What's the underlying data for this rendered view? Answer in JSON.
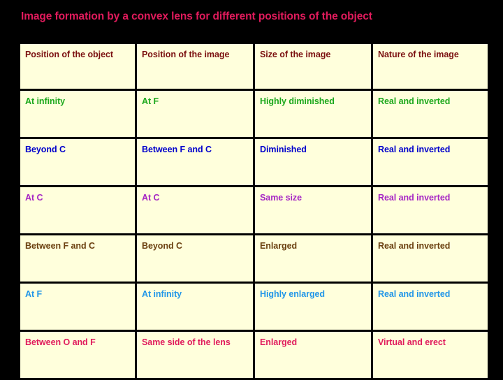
{
  "slide": {
    "title": "Image formation by a convex lens for different positions of the object",
    "title_color": "#e01b5c",
    "background_color": "#000000"
  },
  "table": {
    "cell_background": "#ffffdc",
    "border_color": "#000000",
    "headers": [
      "Position of the object",
      "Position of the image",
      "Size of the image",
      "Nature of the image"
    ],
    "header_color": "#7b1010",
    "rows": [
      {
        "color": "#1ca81c",
        "cells": [
          "At infinity",
          "At F",
          "Highly diminished",
          "Real and inverted"
        ]
      },
      {
        "color": "#0000cc",
        "cells": [
          "Beyond C",
          "Between F and C",
          "Diminished",
          "Real and inverted"
        ]
      },
      {
        "color": "#a626c4",
        "cells": [
          "At C",
          "At C",
          "Same size",
          "Real and inverted"
        ]
      },
      {
        "color": "#6b4010",
        "cells": [
          "Between F and C",
          "Beyond C",
          "Enlarged",
          "Real and inverted"
        ]
      },
      {
        "color": "#2196e8",
        "cells": [
          "At F",
          "At infinity",
          "Highly enlarged",
          "Real and inverted"
        ]
      },
      {
        "color": "#e01b5c",
        "cells": [
          "Between O and F",
          "Same side of the lens",
          "Enlarged",
          "Virtual and erect"
        ]
      }
    ]
  }
}
